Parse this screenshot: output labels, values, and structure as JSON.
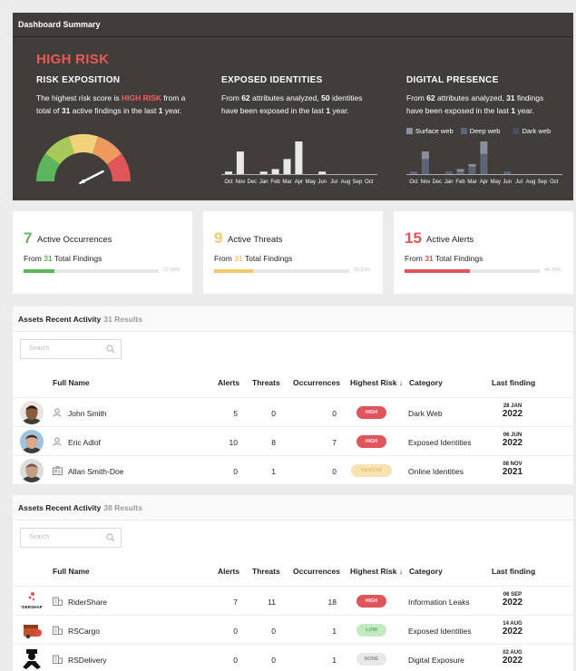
{
  "summary": {
    "title": "Dashboard Summary",
    "risk_level": "HIGH RISK",
    "risk_exposition": {
      "heading": "RISK EXPOSITION",
      "p1": "The highest risk score is ",
      "p2": "HIGH RISK",
      "p3": " from a total of ",
      "p4": "31",
      "p5": " active findings in the last ",
      "p6": "1",
      "p7": " year.",
      "gauge_value": 0.85
    },
    "exposed_identities": {
      "heading": "EXPOSED IDENTITIES",
      "p1": "From ",
      "p2": "62",
      "p3": " attributes analyzed, ",
      "p4": "50",
      "p5": " identities have been exposed in the last ",
      "p6": "1",
      "p7": " year.",
      "chart_data": {
        "type": "bar",
        "categories": [
          "Oct",
          "Nov",
          "Dec",
          "Jan",
          "Feb",
          "Mar",
          "Apr",
          "May",
          "Jun",
          "Jul",
          "Aug",
          "Sep",
          "Oct"
        ],
        "values": [
          1,
          9,
          0,
          1,
          2,
          6,
          13,
          0,
          1,
          0,
          0,
          0,
          0
        ]
      }
    },
    "digital_presence": {
      "heading": "DIGITAL PRESENCE",
      "p1": "From ",
      "p2": "62",
      "p3": " attributes analyzed, ",
      "p4": "31",
      "p5": " findings have been exposed in the last ",
      "p6": "1",
      "p7": " year.",
      "chart_data": {
        "type": "bar",
        "stacked": true,
        "categories": [
          "Oct",
          "Nov",
          "Dec",
          "Jan",
          "Feb",
          "Mar",
          "Apr",
          "May",
          "Jun",
          "Jul",
          "Aug",
          "Sep",
          "Oct"
        ],
        "series": [
          {
            "name": "Surface web",
            "values": [
              0,
              3,
              0,
              0,
              1,
              1,
              5,
              0,
              0,
              0,
              0,
              0,
              0
            ]
          },
          {
            "name": "Deep web",
            "values": [
              1,
              6,
              0,
              1,
              1,
              3,
              8,
              0,
              1,
              0,
              0,
              0,
              0
            ]
          },
          {
            "name": "Dark web",
            "values": [
              0,
              0,
              0,
              0,
              0,
              0,
              0,
              0,
              0,
              0,
              0,
              0,
              0
            ]
          }
        ]
      }
    },
    "colors": {
      "surface": "#8b8f9b",
      "deep": "#5e6478",
      "dark": "#4a4e5c"
    }
  },
  "cards": [
    {
      "count": "7",
      "label": "Active Occurrences",
      "from": "From ",
      "total": "31",
      "tail": " Total Findings",
      "pct_text": "22.58%",
      "fraction": 0.2258,
      "color": "#5db55c"
    },
    {
      "count": "9",
      "label": "Active Threats",
      "from": "From ",
      "total": "31",
      "tail": " Total Findings",
      "pct_text": "29.03%",
      "fraction": 0.2903,
      "color": "#f2c96b"
    },
    {
      "count": "15",
      "label": "Active Alerts",
      "from": "From ",
      "total": "31",
      "tail": " Total Findings",
      "pct_text": "48.39%",
      "fraction": 0.4839,
      "color": "#e0555a"
    }
  ],
  "table1": {
    "title": "Assets Recent Activity",
    "count": "31 Results",
    "search_placeholder": "Search",
    "columns": [
      "Full Name",
      "Alerts",
      "Threats",
      "Occurrences",
      "Highest Risk",
      "Category",
      "Last finding"
    ],
    "rows": [
      {
        "name": "John Smith",
        "alerts": "5",
        "threats": "0",
        "occ": "0",
        "risk": "HIGH",
        "risk_class": "high",
        "category": "Dark Web",
        "date": "28 JAN",
        "year": "2022",
        "kind": "person-icon"
      },
      {
        "name": "Eric Adlof",
        "alerts": "10",
        "threats": "8",
        "occ": "7",
        "risk": "HIGH",
        "risk_class": "high",
        "category": "Exposed Identities",
        "date": "06 JUN",
        "year": "2022",
        "kind": "person-icon"
      },
      {
        "name": "Allan Smith-Doe",
        "alerts": "0",
        "threats": "1",
        "occ": "0",
        "risk": "MEDIUM",
        "risk_class": "medium",
        "category": "Online Identities",
        "date": "08 NOV",
        "year": "2021",
        "kind": "id-card-icon"
      }
    ]
  },
  "table2": {
    "title": "Assets Recent Activity",
    "count": "38 Results",
    "search_placeholder": "Search",
    "columns": [
      "Full Name",
      "Alerts",
      "Threats",
      "Occurrences",
      "Highest Risk",
      "Category",
      "Last finding"
    ],
    "rows": [
      {
        "name": "RiderShare",
        "alerts": "7",
        "threats": "11",
        "occ": "18",
        "risk": "HIGH",
        "risk_class": "high",
        "category": "Information Leaks",
        "date": "06 SEP",
        "year": "2022",
        "kind": "building-icon",
        "logo_text": "RIDERSHARE"
      },
      {
        "name": "RSCargo",
        "alerts": "0",
        "threats": "0",
        "occ": "1",
        "risk": "LOW",
        "risk_class": "low",
        "category": "Exposed Identities",
        "date": "14 AUG",
        "year": "2022",
        "kind": "building-icon"
      },
      {
        "name": "RSDelivery",
        "alerts": "0",
        "threats": "0",
        "occ": "1",
        "risk": "NONE",
        "risk_class": "none",
        "category": "Digital Exposure",
        "date": "02 AUG",
        "year": "2022",
        "kind": "building-icon"
      }
    ]
  }
}
